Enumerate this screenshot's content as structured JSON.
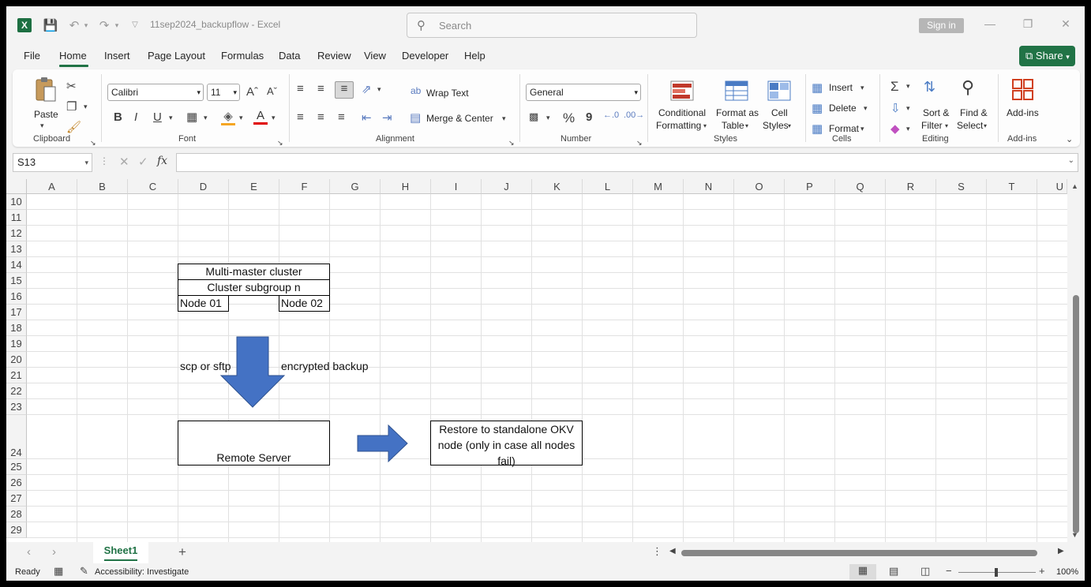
{
  "app": {
    "title": "11sep2024_backupflow  -  Excel",
    "search_placeholder": "Search",
    "sign_in": "Sign in",
    "share": "Share"
  },
  "menu": [
    "File",
    "Home",
    "Insert",
    "Page Layout",
    "Formulas",
    "Data",
    "Review",
    "View",
    "Developer",
    "Help"
  ],
  "ribbon": {
    "clipboard": {
      "paste": "Paste",
      "label": "Clipboard"
    },
    "font": {
      "name": "Calibri",
      "size": "11",
      "bold": "B",
      "italic": "I",
      "underline": "U",
      "label": "Font"
    },
    "alignment": {
      "wrap": "Wrap Text",
      "merge": "Merge & Center",
      "label": "Alignment"
    },
    "number": {
      "format": "General",
      "percent": "%",
      "comma": "9",
      "label": "Number"
    },
    "styles": {
      "conditional1": "Conditional",
      "conditional2": "Formatting",
      "table1": "Format as",
      "table2": "Table",
      "cell1": "Cell",
      "cell2": "Styles",
      "label": "Styles"
    },
    "cells": {
      "insert": "Insert",
      "delete": "Delete",
      "format": "Format",
      "label": "Cells"
    },
    "editing": {
      "sort1": "Sort &",
      "sort2": "Filter",
      "find1": "Find &",
      "find2": "Select",
      "label": "Editing"
    },
    "addins": {
      "button": "Add-ins",
      "label": "Add-ins"
    }
  },
  "formula_bar": {
    "name_box": "S13",
    "fx": "fx",
    "value": ""
  },
  "columns": [
    "A",
    "B",
    "C",
    "D",
    "E",
    "F",
    "G",
    "H",
    "I",
    "J",
    "K",
    "L",
    "M",
    "N",
    "O",
    "P",
    "Q",
    "R",
    "S",
    "T",
    "U"
  ],
  "rows": [
    "10",
    "11",
    "12",
    "13",
    "14",
    "15",
    "16",
    "17",
    "18",
    "19",
    "20",
    "21",
    "22",
    "23",
    "24",
    "25",
    "26",
    "27",
    "28",
    "29"
  ],
  "diagram": {
    "cluster": "Multi-master cluster",
    "subgroup": "Cluster subgroup n",
    "node1": "Node 01",
    "node2": "Node 02",
    "transfer_left": "scp or sftp",
    "transfer_right": "encrypted backup",
    "remote": "Remote Server",
    "restore": "Restore to standalone OKV node (only in case all nodes fail)",
    "arrow_color": "#4472C4"
  },
  "sheets": {
    "active": "Sheet1"
  },
  "status": {
    "ready": "Ready",
    "accessibility": "Accessibility: Investigate",
    "zoom": "100%"
  }
}
